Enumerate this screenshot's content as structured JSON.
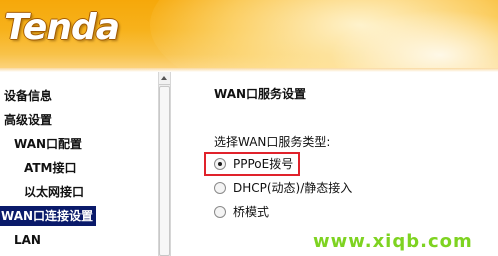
{
  "brand": {
    "logo_text": "Tenda"
  },
  "sidebar": {
    "items": [
      {
        "label": "设备信息"
      },
      {
        "label": "高级设置"
      },
      {
        "label": "WAN口配置"
      },
      {
        "label": "ATM接口"
      },
      {
        "label": "以太网接口"
      },
      {
        "label": "WAN口连接设置",
        "selected": true
      },
      {
        "label": "LAN"
      }
    ]
  },
  "main": {
    "section_title": "WAN口服务设置",
    "service_type_label": "选择WAN口服务类型:",
    "options": [
      {
        "label": "PPPoE拨号",
        "checked": true
      },
      {
        "label": "DHCP(动态)/静态接入",
        "checked": false
      },
      {
        "label": "桥模式",
        "checked": false
      }
    ]
  },
  "watermark": {
    "text": "www.xiqb.com"
  },
  "colors": {
    "header_orange": "#f7b21c",
    "selected_bg": "#0a1a6a",
    "highlight_red": "#e0222b",
    "watermark_green": "#7ed321"
  }
}
